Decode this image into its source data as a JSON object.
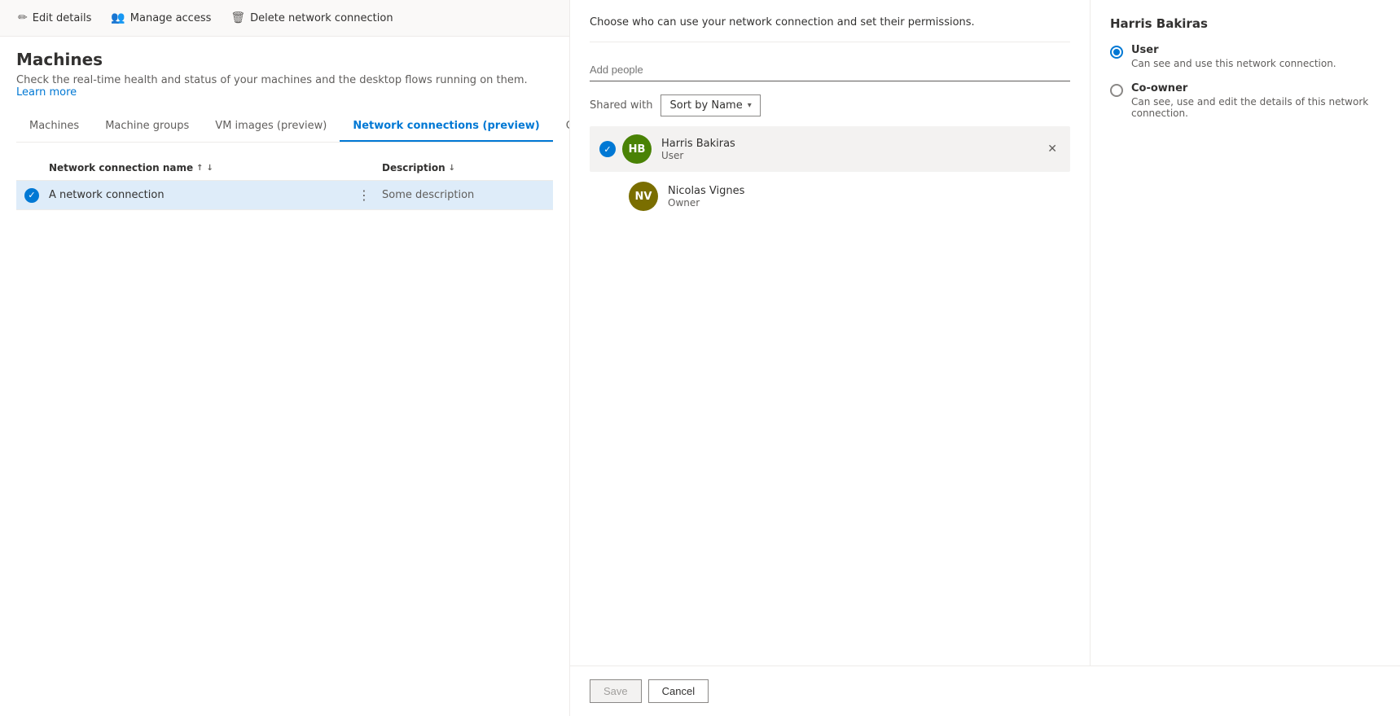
{
  "toolbar": {
    "edit_label": "Edit details",
    "manage_label": "Manage access",
    "delete_label": "Delete network connection",
    "edit_icon": "✏️",
    "manage_icon": "👥",
    "delete_icon": "🗑️"
  },
  "page": {
    "title": "Machines",
    "subtitle": "Check the real-time health and status of your machines and the desktop flows running on them.",
    "learn_more": "Learn more"
  },
  "tabs": [
    {
      "label": "Machines",
      "active": false
    },
    {
      "label": "Machine groups",
      "active": false
    },
    {
      "label": "VM images (preview)",
      "active": false
    },
    {
      "label": "Network connections (preview)",
      "active": true
    },
    {
      "label": "Gateways",
      "active": false
    }
  ],
  "list": {
    "col_name": "Network connection name",
    "col_desc": "Description",
    "rows": [
      {
        "name": "A network connection",
        "description": "Some description",
        "selected": true
      }
    ]
  },
  "manage_access": {
    "description": "Choose who can use your network connection and set their permissions.",
    "add_people_placeholder": "Add people",
    "shared_with_label": "Shared with",
    "sort_label": "Sort by Name",
    "people": [
      {
        "initials": "HB",
        "name": "Harris Bakiras",
        "role": "User",
        "avatar_color": "#498205",
        "selected": true
      },
      {
        "initials": "NV",
        "name": "Nicolas Vignes",
        "role": "Owner",
        "avatar_color": "#7a6e00",
        "selected": false
      }
    ]
  },
  "permission_panel": {
    "user_name": "Harris Bakiras",
    "roles": [
      {
        "label": "User",
        "description": "Can see and use this network connection.",
        "checked": true
      },
      {
        "label": "Co-owner",
        "description": "Can see, use and edit the details of this network connection.",
        "checked": false
      }
    ]
  },
  "footer": {
    "save_label": "Save",
    "cancel_label": "Cancel"
  }
}
